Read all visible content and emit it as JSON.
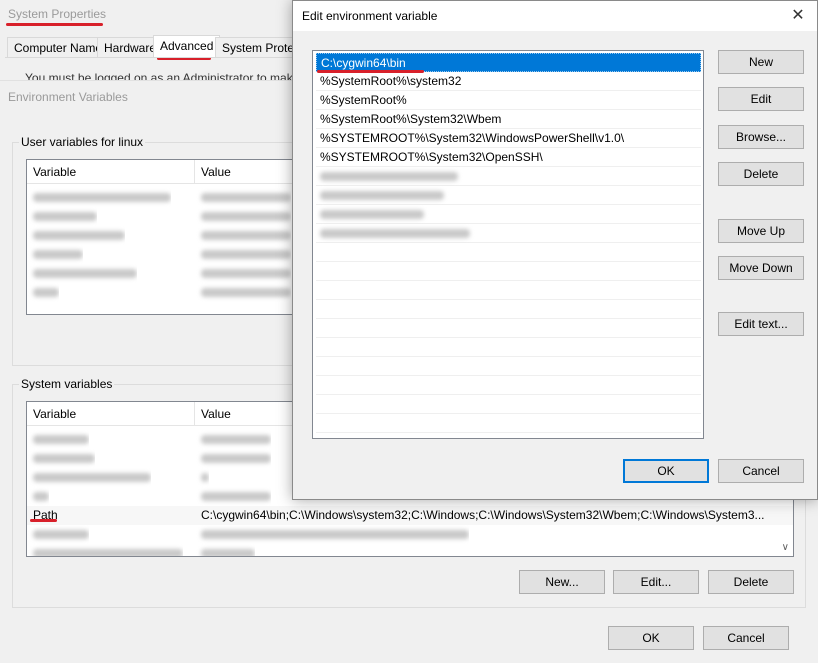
{
  "system_properties": {
    "title": "System Properties",
    "tabs": [
      "Computer Name",
      "Hardware",
      "Advanced",
      "System Protecti"
    ],
    "active_tab": "Advanced",
    "admin_note": "You must be logged on as an Administrator to make most"
  },
  "environment_variables": {
    "title": "Environment Variables",
    "user_group_label": "User variables for linux",
    "user_columns": [
      "Variable",
      "Value"
    ],
    "system_group_label": "System variables",
    "system_columns": [
      "Variable",
      "Value"
    ],
    "path_row": {
      "variable": "Path",
      "value": "C:\\cygwin64\\bin;C:\\Windows\\system32;C:\\Windows;C:\\Windows\\System32\\Wbem;C:\\Windows\\System3..."
    },
    "buttons": {
      "new": "New...",
      "edit": "Edit...",
      "delete": "Delete",
      "ok": "OK",
      "cancel": "Cancel"
    },
    "scroll_arrow_icon": "chevron-down-icon"
  },
  "edit_dialog": {
    "title": "Edit environment variable",
    "close_icon": "close-icon",
    "paths": [
      "C:\\cygwin64\\bin",
      "%SystemRoot%\\system32",
      "%SystemRoot%",
      "%SystemRoot%\\System32\\Wbem",
      "%SYSTEMROOT%\\System32\\WindowsPowerShell\\v1.0\\",
      "%SYSTEMROOT%\\System32\\OpenSSH\\"
    ],
    "selected_index": 0,
    "buttons": {
      "new": "New",
      "edit": "Edit",
      "browse": "Browse...",
      "delete": "Delete",
      "move_up": "Move Up",
      "move_down": "Move Down",
      "edit_text": "Edit text...",
      "ok": "OK",
      "cancel": "Cancel"
    }
  },
  "colors": {
    "selection": "#0078d7",
    "annotation_red": "#d8202a",
    "window_bg": "#f0f0f0"
  }
}
